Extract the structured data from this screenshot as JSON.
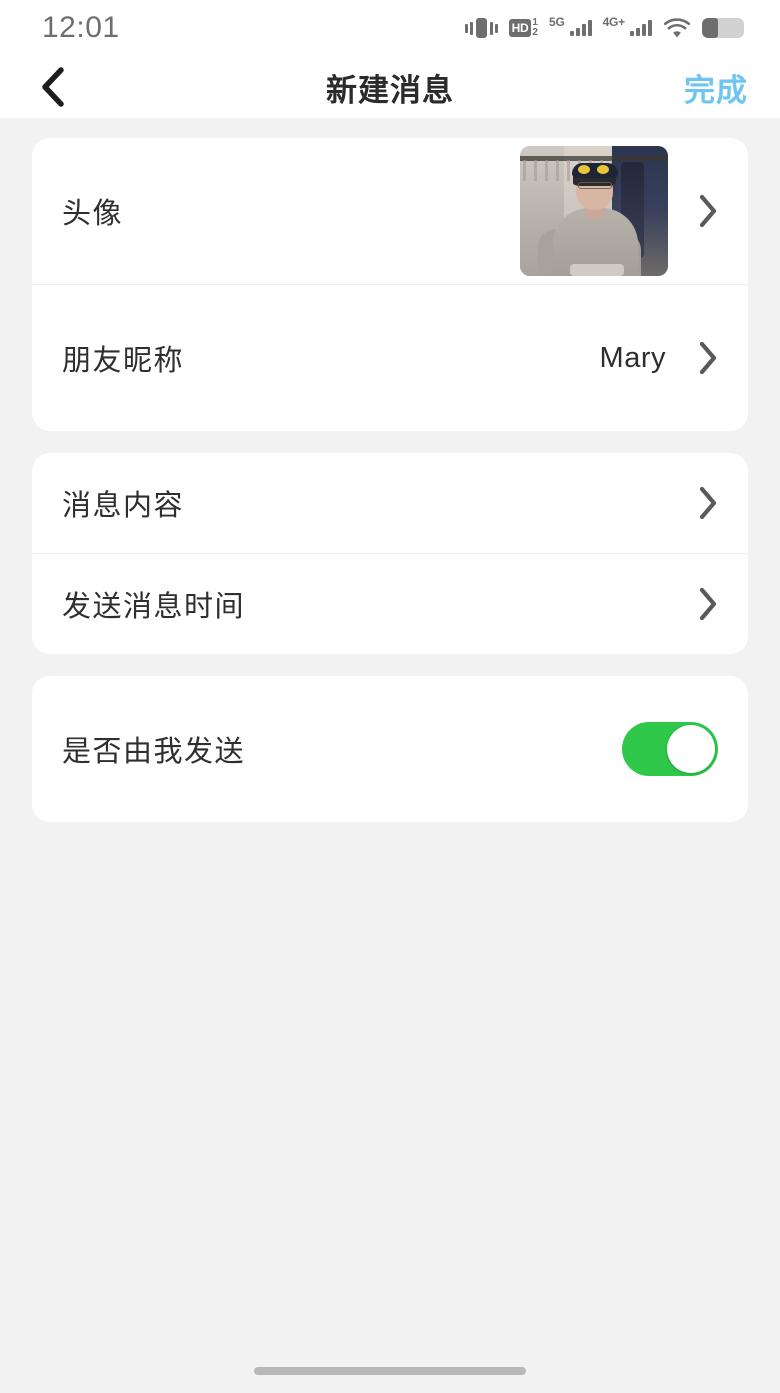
{
  "status_bar": {
    "time": "12:01",
    "icons": [
      {
        "name": "vibrate-icon"
      },
      {
        "name": "hd-icon",
        "label": "HD",
        "sup": "1",
        "sub": "2"
      },
      {
        "name": "signal-5g-icon",
        "label": "5G",
        "bars": 4
      },
      {
        "name": "signal-4g-plus-icon",
        "label": "4G+",
        "bars": 4
      },
      {
        "name": "wifi-icon"
      },
      {
        "name": "battery-icon",
        "level_percent": 38
      }
    ]
  },
  "nav": {
    "back_icon": "chevron-left-icon",
    "title": "新建消息",
    "done_label": "完成",
    "done_color": "#6dc5f0"
  },
  "sections": [
    {
      "rows": [
        {
          "label": "头像",
          "type": "avatar",
          "avatar_alt": "person-photo",
          "chevron": "chevron-right-icon"
        },
        {
          "label": "朋友昵称",
          "type": "value",
          "value": "Mary",
          "chevron": "chevron-right-icon"
        }
      ]
    },
    {
      "rows": [
        {
          "label": "消息内容",
          "type": "link",
          "value": "",
          "chevron": "chevron-right-icon"
        },
        {
          "label": "发送消息时间",
          "type": "link",
          "value": "",
          "chevron": "chevron-right-icon"
        }
      ]
    },
    {
      "rows": [
        {
          "label": "是否由我发送",
          "type": "toggle",
          "toggle_on": true,
          "toggle_color": "#2fc84a"
        }
      ]
    }
  ],
  "home_indicator": {
    "name": "home-indicator"
  }
}
